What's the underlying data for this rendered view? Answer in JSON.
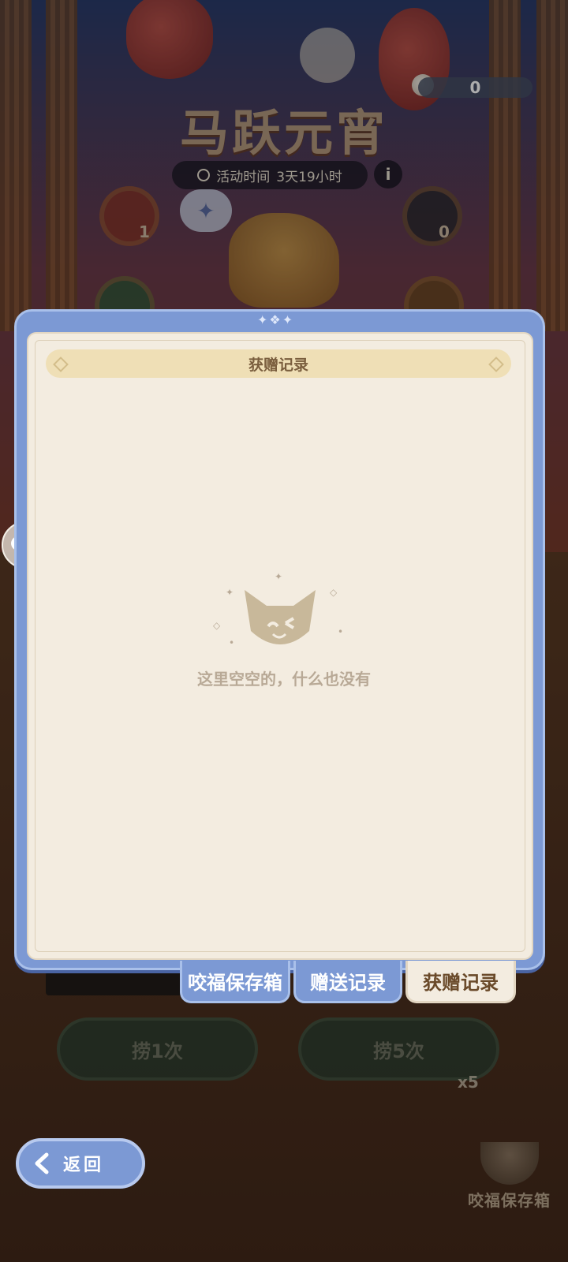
{
  "currency": {
    "value": "0",
    "icon": "spoon-icon"
  },
  "event": {
    "title": "马跃元宵",
    "time_label": "活动时间",
    "time_remaining": "3天19小时"
  },
  "coins": {
    "left_count": "1",
    "right_count": "0"
  },
  "modal": {
    "header": "获赠记录",
    "empty_message": "这里空空的，什么也没有"
  },
  "tabs": [
    {
      "label": "咬福保存箱",
      "active": false
    },
    {
      "label": "赠送记录",
      "active": false
    },
    {
      "label": "获赠记录",
      "active": true
    }
  ],
  "actions": {
    "ladle_once": "捞1次",
    "ladle_five": "捞5次",
    "five_badge": "x5"
  },
  "back": {
    "label": "返回"
  },
  "savebox": {
    "label": "咬福保存箱"
  },
  "colors": {
    "frame_blue": "#7c99d4",
    "paper": "#f3ece0",
    "header_band": "#efdfb6"
  }
}
